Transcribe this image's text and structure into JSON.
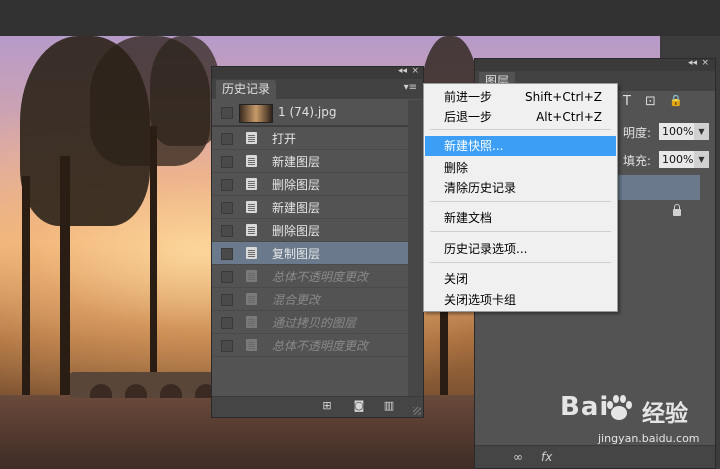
{
  "history_panel": {
    "tab_title": "历史记录",
    "collapse_glyph": "◂◂",
    "close_glyph": "×",
    "menu_glyph": "▾≡",
    "snapshot": {
      "label": "1 (74).jpg"
    },
    "items": [
      {
        "label": "打开",
        "state": "active"
      },
      {
        "label": "新建图层",
        "state": "active"
      },
      {
        "label": "删除图层",
        "state": "active"
      },
      {
        "label": "新建图层",
        "state": "active"
      },
      {
        "label": "删除图层",
        "state": "active"
      },
      {
        "label": "复制图层",
        "state": "selected"
      },
      {
        "label": "总体不透明度更改",
        "state": "dimmed"
      },
      {
        "label": "混合更改",
        "state": "dimmed"
      },
      {
        "label": "通过拷贝的图层",
        "state": "dimmed"
      },
      {
        "label": "总体不透明度更改",
        "state": "dimmed"
      }
    ],
    "bottom_icons": [
      "new-document-from-state-icon",
      "camera-icon",
      "trash-icon"
    ]
  },
  "layers_panel": {
    "tab_title": "图层",
    "collapse_glyph": "◂◂",
    "close_glyph": "×",
    "opacity_label": "明度:",
    "opacity_value": "100%",
    "fill_label": "填充:",
    "fill_value": "100%",
    "tool_glyphs": [
      "T",
      "⊡",
      "🔒"
    ],
    "bottom_glyphs": [
      "∞",
      "fx"
    ]
  },
  "context_menu": {
    "items": [
      {
        "label": "前进一步",
        "shortcut": "Shift+Ctrl+Z"
      },
      {
        "label": "后退一步",
        "shortcut": "Alt+Ctrl+Z"
      },
      {
        "label": "新建快照...",
        "highlighted": true
      },
      {
        "label": "删除"
      },
      {
        "label": "清除历史记录"
      },
      {
        "label": "新建文档"
      },
      {
        "label": "历史记录选项..."
      },
      {
        "label": "关闭"
      },
      {
        "label": "关闭选项卡组"
      }
    ]
  },
  "watermark": {
    "brand": "Bai",
    "brand_cn": "经验",
    "url": "jingyan.baidu.com"
  },
  "colors": {
    "panel_bg": "#535353",
    "selection": "#6a7a8c",
    "menu_highlight": "#3c9ff5"
  }
}
